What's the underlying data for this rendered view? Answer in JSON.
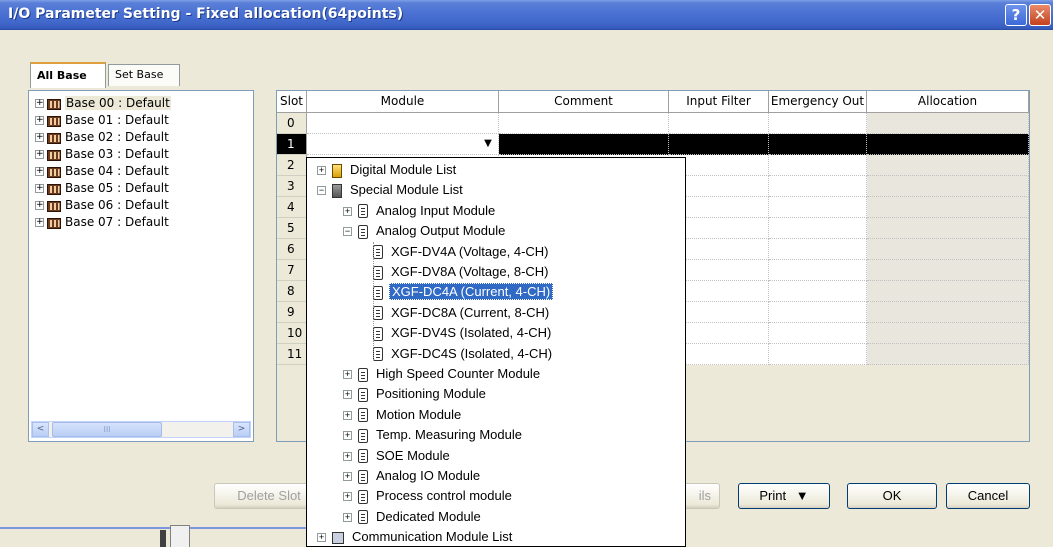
{
  "window": {
    "title": "I/O Parameter Setting - Fixed allocation(64points)",
    "help_glyph": "?",
    "close_glyph": "✕"
  },
  "tabs": [
    {
      "label": "All Base",
      "active": true
    },
    {
      "label": "Set Base",
      "active": false
    }
  ],
  "base_tree": [
    "Base 00 : Default",
    "Base 01 : Default",
    "Base 02 : Default",
    "Base 03 : Default",
    "Base 04 : Default",
    "Base 05 : Default",
    "Base 06 : Default",
    "Base 07 : Default"
  ],
  "scrollbar": {
    "left_glyph": "<",
    "right_glyph": ">",
    "thumb_grip": "III"
  },
  "grid": {
    "columns": [
      "Slot",
      "Module",
      "Comment",
      "Input Filter",
      "Emergency Out",
      "Allocation"
    ],
    "slots": [
      "0",
      "1",
      "2",
      "3",
      "4",
      "5",
      "6",
      "7",
      "8",
      "9",
      "10",
      "11"
    ],
    "selected_slot": "1",
    "dropdown_glyph": "▼"
  },
  "dropdown": {
    "items": [
      {
        "label": "Digital Module List",
        "expander": "+",
        "icon": "digital-category-icon"
      },
      {
        "label": "Special Module List",
        "expander": "−",
        "icon": "special-category-icon"
      },
      {
        "label": "Analog Input Module",
        "expander": "+",
        "icon": "module-icon"
      },
      {
        "label": "Analog Output Module",
        "expander": "−",
        "icon": "module-icon"
      },
      {
        "label": "XGF-DV4A (Voltage, 4-CH)",
        "icon": "module-icon"
      },
      {
        "label": "XGF-DV8A (Voltage, 8-CH)",
        "icon": "module-icon"
      },
      {
        "label": "XGF-DC4A (Current, 4-CH)",
        "icon": "module-icon",
        "highlight": true
      },
      {
        "label": "XGF-DC8A (Current, 8-CH)",
        "icon": "module-icon"
      },
      {
        "label": "XGF-DV4S (Isolated, 4-CH)",
        "icon": "module-icon"
      },
      {
        "label": "XGF-DC4S (Isolated, 4-CH)",
        "icon": "module-icon"
      },
      {
        "label": "High Speed Counter Module",
        "expander": "+",
        "icon": "module-icon"
      },
      {
        "label": "Positioning Module",
        "expander": "+",
        "icon": "module-icon"
      },
      {
        "label": "Motion Module",
        "expander": "+",
        "icon": "module-icon"
      },
      {
        "label": "Temp. Measuring Module",
        "expander": "+",
        "icon": "module-icon"
      },
      {
        "label": "SOE Module",
        "expander": "+",
        "icon": "module-icon"
      },
      {
        "label": "Analog IO Module",
        "expander": "+",
        "icon": "module-icon"
      },
      {
        "label": "Process control module",
        "expander": "+",
        "icon": "module-icon"
      },
      {
        "label": "Dedicated Module",
        "expander": "+",
        "icon": "module-icon"
      },
      {
        "label": "Communication Module List",
        "expander": "+",
        "icon": "communication-category-icon"
      }
    ]
  },
  "buttons": {
    "delete_slot": "Delete Slot",
    "details_partial": "ils",
    "print": "Print",
    "print_arrow": "▼",
    "ok": "OK",
    "cancel": "Cancel"
  }
}
